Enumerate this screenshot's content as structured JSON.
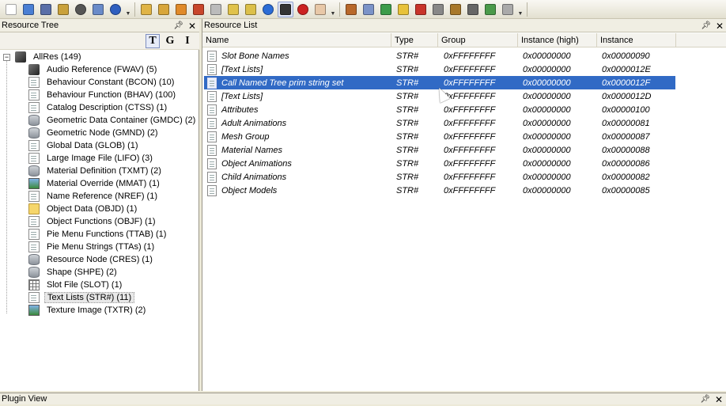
{
  "toolbar": {
    "buttons": [
      {
        "name": "new-file",
        "color": "#ffffff"
      },
      {
        "name": "open-folder",
        "color": "#4a7fd4"
      },
      {
        "name": "save",
        "color": "#5a6fa8"
      },
      {
        "name": "save-as",
        "color": "#c9a13c"
      },
      {
        "name": "close",
        "color": "#555555"
      },
      {
        "name": "users",
        "color": "#6a8bc9"
      },
      {
        "name": "scan",
        "color": "#2f5fbf"
      },
      {
        "name": "open-pkg",
        "color": "#e0b446"
      },
      {
        "name": "save-pkg",
        "color": "#d8a63b"
      },
      {
        "name": "undo",
        "color": "#e08a2a"
      },
      {
        "name": "delete",
        "color": "#c8462b"
      },
      {
        "name": "comment",
        "color": "#bbbbbb"
      },
      {
        "name": "note",
        "color": "#e0c24a"
      },
      {
        "name": "note2",
        "color": "#dcc04a"
      },
      {
        "name": "refresh",
        "color": "#2b6cd6"
      },
      {
        "name": "object",
        "color": "#333333"
      },
      {
        "name": "fix",
        "color": "#cc2222"
      },
      {
        "name": "eraser",
        "color": "#e8c8a8"
      },
      {
        "name": "house",
        "color": "#b8682a"
      },
      {
        "name": "scene",
        "color": "#7b93c8"
      },
      {
        "name": "grid",
        "color": "#3c9c4a"
      },
      {
        "name": "gem",
        "color": "#e8c23a"
      },
      {
        "name": "battery",
        "color": "#c8342a"
      },
      {
        "name": "tools",
        "color": "#888888"
      },
      {
        "name": "building",
        "color": "#a8782a"
      },
      {
        "name": "camera",
        "color": "#666666"
      },
      {
        "name": "people",
        "color": "#4a9a4a"
      },
      {
        "name": "person",
        "color": "#aaaaaa"
      }
    ]
  },
  "tree_panel": {
    "title": "Resource Tree",
    "filters": [
      "T",
      "G",
      "I"
    ],
    "root": "AllRes (149)",
    "items": [
      {
        "label": "Audio Reference (FWAV) (5)",
        "icon": "cube"
      },
      {
        "label": "Behaviour Constant (BCON) (10)",
        "icon": "page"
      },
      {
        "label": "Behaviour Function (BHAV) (100)",
        "icon": "page"
      },
      {
        "label": "Catalog Description (CTSS) (1)",
        "icon": "page"
      },
      {
        "label": "Geometric Data Container (GMDC) (2)",
        "icon": "db"
      },
      {
        "label": "Geometric Node (GMND) (2)",
        "icon": "db"
      },
      {
        "label": "Global Data (GLOB) (1)",
        "icon": "page"
      },
      {
        "label": "Large Image File (LIFO) (3)",
        "icon": "page"
      },
      {
        "label": "Material Definition (TXMT) (2)",
        "icon": "db"
      },
      {
        "label": "Material Override (MMAT) (1)",
        "icon": "img"
      },
      {
        "label": "Name Reference (NREF) (1)",
        "icon": "page"
      },
      {
        "label": "Object Data (OBJD) (1)",
        "icon": "folder"
      },
      {
        "label": "Object Functions (OBJF) (1)",
        "icon": "page"
      },
      {
        "label": "Pie Menu Functions (TTAB) (1)",
        "icon": "page"
      },
      {
        "label": "Pie Menu Strings (TTAs) (1)",
        "icon": "page"
      },
      {
        "label": "Resource Node (CRES) (1)",
        "icon": "db"
      },
      {
        "label": "Shape (SHPE) (2)",
        "icon": "db"
      },
      {
        "label": "Slot File (SLOT) (1)",
        "icon": "grid"
      },
      {
        "label": "Text Lists (STR#) (11)",
        "icon": "page",
        "selected": true
      },
      {
        "label": "Texture Image (TXTR) (2)",
        "icon": "img"
      }
    ]
  },
  "list_panel": {
    "title": "Resource List",
    "columns": [
      "Name",
      "Type",
      "Group",
      "Instance (high)",
      "Instance"
    ],
    "rows": [
      {
        "name": "Slot Bone Names",
        "type": "STR#",
        "group": "0xFFFFFFFF",
        "inst_high": "0x00000000",
        "inst": "0x00000090"
      },
      {
        "name": "[Text Lists]",
        "type": "STR#",
        "group": "0xFFFFFFFF",
        "inst_high": "0x00000000",
        "inst": "0x0000012E"
      },
      {
        "name": "Call Named Tree prim string set",
        "type": "STR#",
        "group": "0xFFFFFFFF",
        "inst_high": "0x00000000",
        "inst": "0x0000012F",
        "selected": true
      },
      {
        "name": "[Text Lists]",
        "type": "STR#",
        "group": "0xFFFFFFFF",
        "inst_high": "0x00000000",
        "inst": "0x0000012D"
      },
      {
        "name": "Attributes",
        "type": "STR#",
        "group": "0xFFFFFFFF",
        "inst_high": "0x00000000",
        "inst": "0x00000100"
      },
      {
        "name": "Adult Animations",
        "type": "STR#",
        "group": "0xFFFFFFFF",
        "inst_high": "0x00000000",
        "inst": "0x00000081"
      },
      {
        "name": "Mesh Group",
        "type": "STR#",
        "group": "0xFFFFFFFF",
        "inst_high": "0x00000000",
        "inst": "0x00000087"
      },
      {
        "name": "Material Names",
        "type": "STR#",
        "group": "0xFFFFFFFF",
        "inst_high": "0x00000000",
        "inst": "0x00000088"
      },
      {
        "name": "Object Animations",
        "type": "STR#",
        "group": "0xFFFFFFFF",
        "inst_high": "0x00000000",
        "inst": "0x00000086"
      },
      {
        "name": "Child Animations",
        "type": "STR#",
        "group": "0xFFFFFFFF",
        "inst_high": "0x00000000",
        "inst": "0x00000082"
      },
      {
        "name": "Object Models",
        "type": "STR#",
        "group": "0xFFFFFFFF",
        "inst_high": "0x00000000",
        "inst": "0x00000085"
      }
    ]
  },
  "plugin_panel": {
    "title": "Plugin View"
  },
  "header_buttons": {
    "pin": "ᵖ",
    "close": "✕"
  }
}
